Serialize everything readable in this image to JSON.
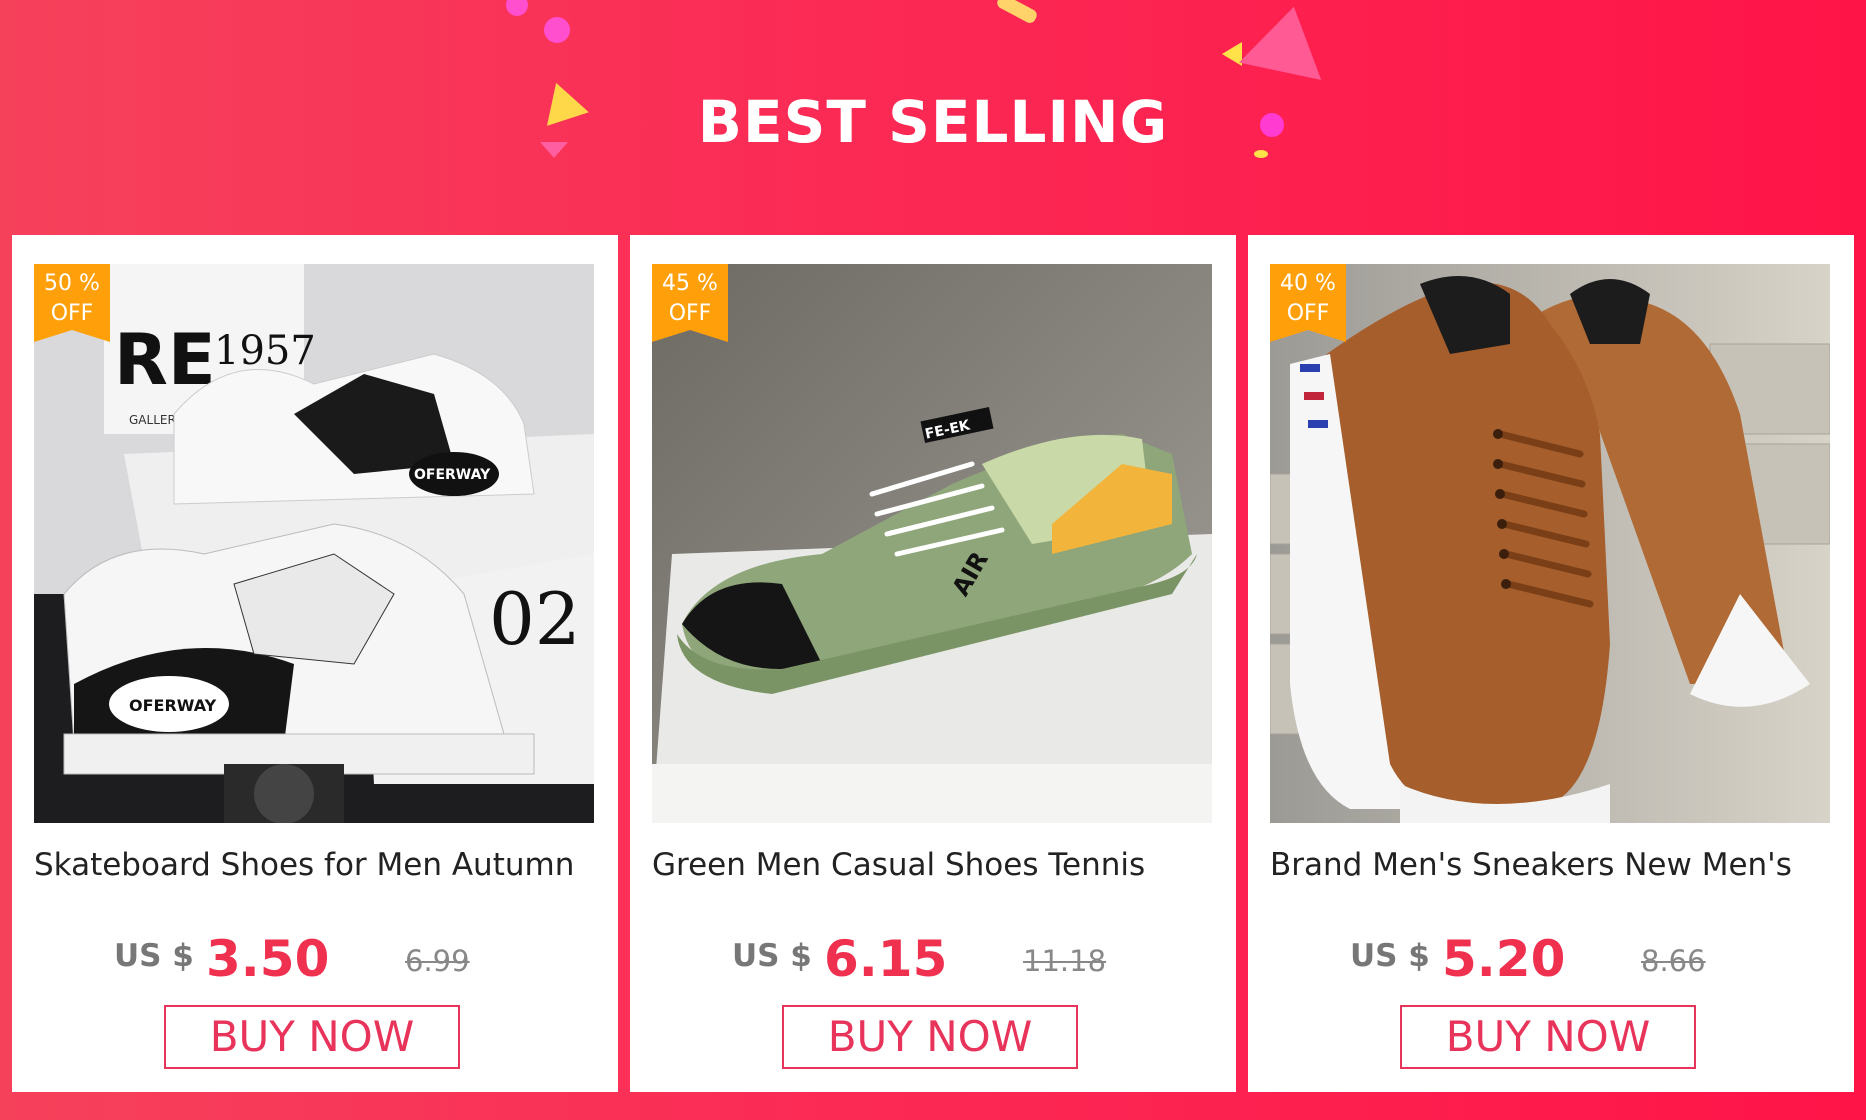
{
  "header": {
    "title": "BEST SELLING"
  },
  "products": [
    {
      "discount_line1": "50 %",
      "discount_line2": "OFF",
      "name": "Skateboard Shoes for Men Autumn",
      "currency": "US $",
      "price": "3.50",
      "original_price": "6.99",
      "button_label": "BUY NOW"
    },
    {
      "discount_line1": "45 %",
      "discount_line2": "OFF",
      "name": "Green Men Casual Shoes Tennis",
      "currency": "US $",
      "price": "6.15",
      "original_price": "11.18",
      "button_label": "BUY NOW"
    },
    {
      "discount_line1": "40 %",
      "discount_line2": "OFF",
      "name": "Brand Men's Sneakers New Men's",
      "currency": "US $",
      "price": "5.20",
      "original_price": "8.66",
      "button_label": "BUY NOW"
    }
  ],
  "colors": {
    "banner_start": "#f6415b",
    "banner_end": "#ff1448",
    "badge": "#ff9f0a",
    "price": "#f0304f",
    "button_border": "#e8335a"
  }
}
